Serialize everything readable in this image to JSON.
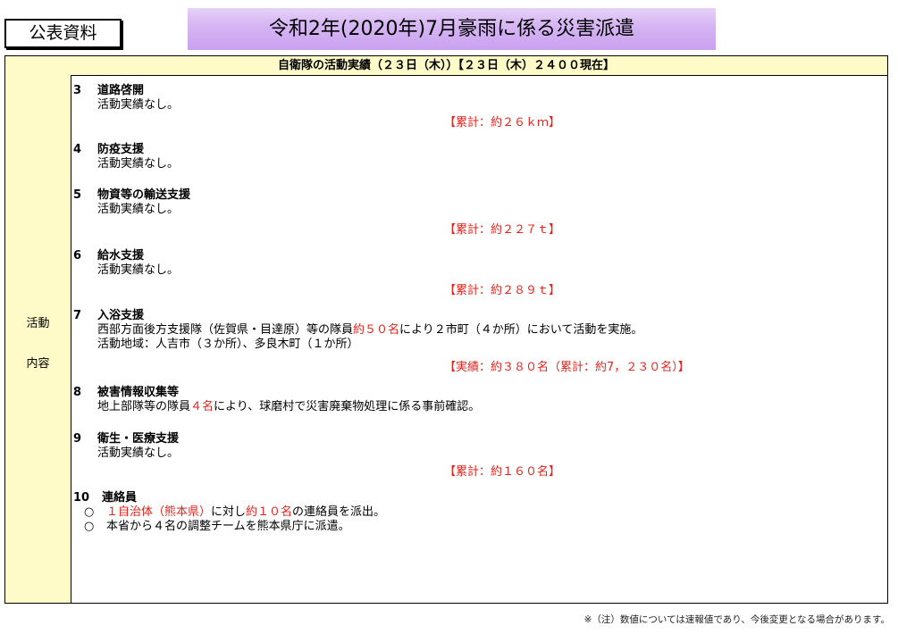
{
  "badge": "公表資料",
  "title": "令和2年(2020年)7月豪雨に係る災害派遣",
  "table_header": "自衛隊の活動実績（２３日（木））【２３日（木）２４００現在】",
  "side_label": {
    "line1": "活動",
    "line2": "内容"
  },
  "sections": [
    {
      "num": "3",
      "title": "道路啓開",
      "text": "活動実績なし。",
      "cumulative": "【累計：約２６ｋｍ】"
    },
    {
      "num": "4",
      "title": "防疫支援",
      "text": "活動実績なし。"
    },
    {
      "num": "5",
      "title": "物資等の輸送支援",
      "text": "活動実績なし。",
      "cumulative": "【累計：約２２７ｔ】"
    },
    {
      "num": "6",
      "title": "給水支援",
      "text": "活動実績なし。",
      "cumulative": "【累計：約２８９ｔ】"
    },
    {
      "num": "7",
      "title": "入浴支援",
      "line1_a": "西部方面後方支援隊（佐賀県・目達原）等の隊員",
      "line1_red": "約５０名",
      "line1_b": "により２市町（４か所）において活動を実施。",
      "line2": "活動地域：人吉市（３か所）、多良木町（１か所）",
      "cumulative": "【実績：約３８０名（累計：約7，２３０名）】"
    },
    {
      "num": "8",
      "title": "被害情報収集等",
      "line1_a": "地上部隊等の隊員",
      "line1_red": "４名",
      "line1_b": "により、球磨村で災害廃棄物処理に係る事前確認。"
    },
    {
      "num": "9",
      "title": "衛生・医療支援",
      "text": "活動実績なし。",
      "cumulative": "【累計：約１６０名】"
    },
    {
      "num": "10",
      "title": "連絡員",
      "bullet": "○",
      "b1_red1": "１自治体（熊本県）",
      "b1_mid": "に対し",
      "b1_red2": "約１０名",
      "b1_end": "の連絡員を派出。",
      "b2": "本省から４名の調整チームを熊本県庁に派遣。"
    }
  ],
  "footnote": "※（注）数値については速報値であり、今後変更となる場合があります。"
}
